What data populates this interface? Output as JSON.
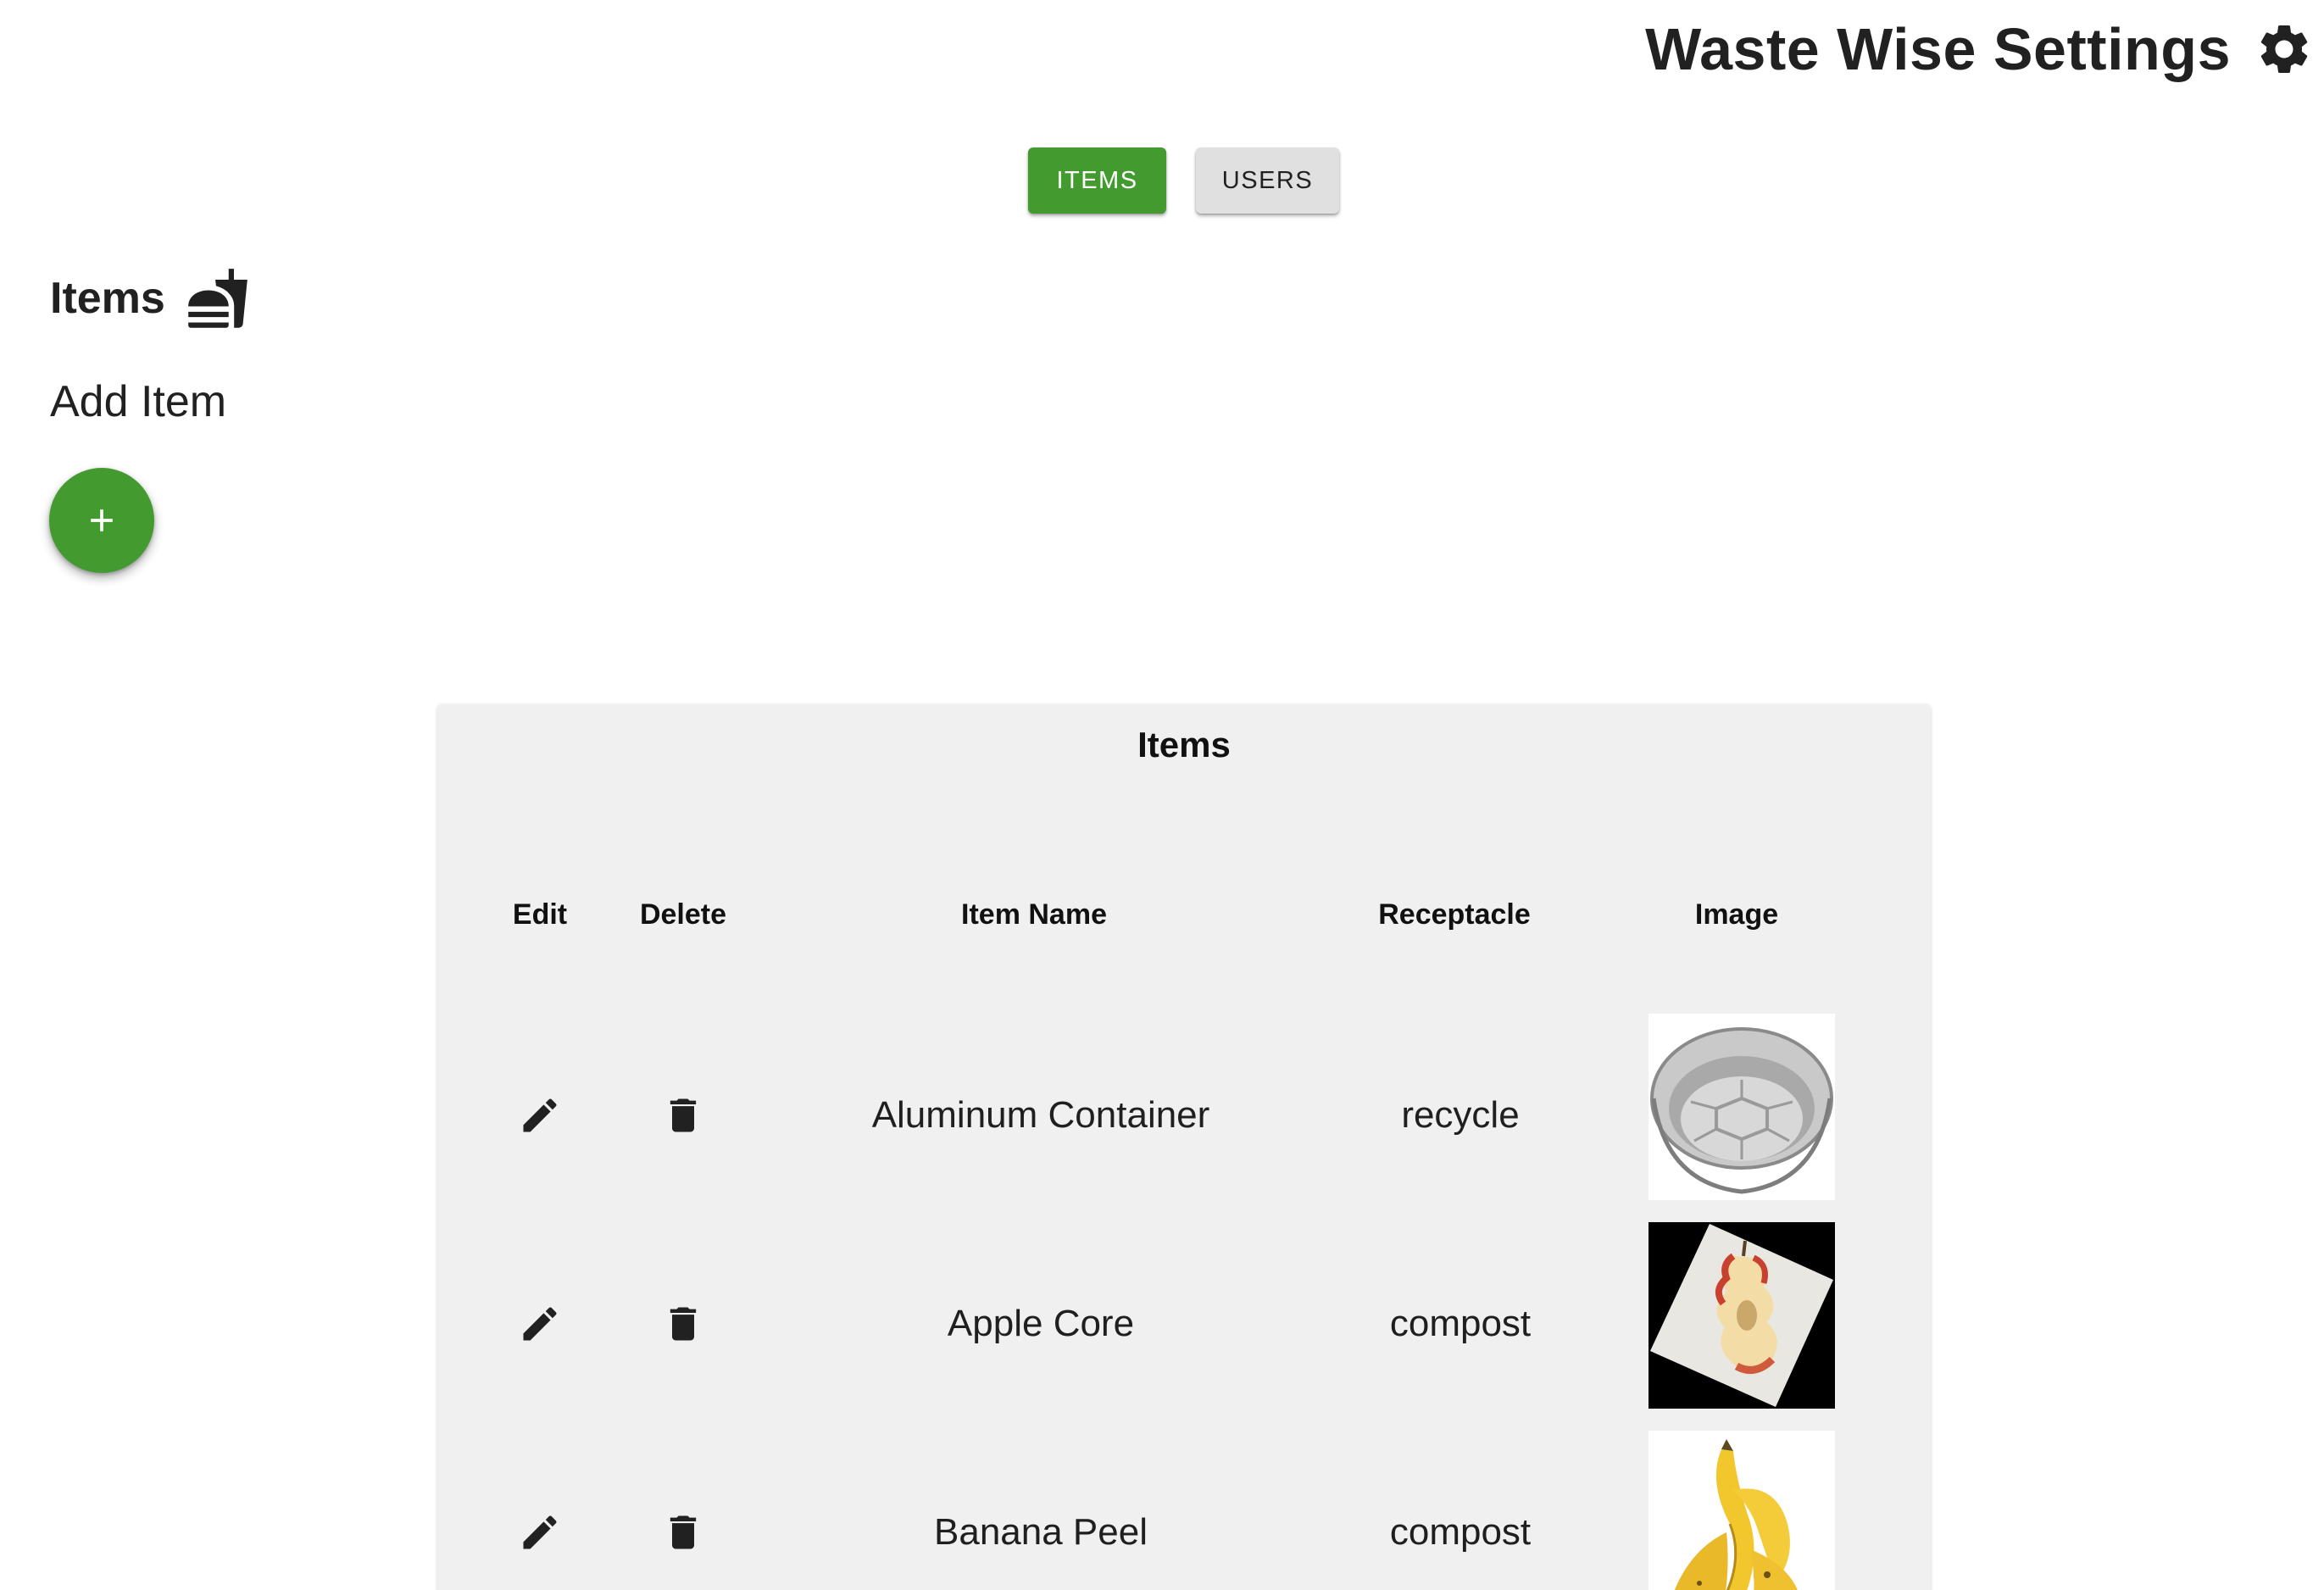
{
  "header": {
    "title": "Waste Wise Settings",
    "settings_icon": "gear-icon"
  },
  "tabs": [
    {
      "label": "ITEMS",
      "active": true,
      "color": "#439a2f"
    },
    {
      "label": "USERS",
      "active": false,
      "color": "#e0e0e0"
    }
  ],
  "section": {
    "title": "Items",
    "icon": "fastfood-icon",
    "add_label": "Add Item",
    "add_icon": "plus-icon"
  },
  "table": {
    "title": "Items",
    "columns": [
      "Edit",
      "Delete",
      "Item Name",
      "Receptacle",
      "Image"
    ],
    "rows": [
      {
        "item_name": "Aluminum Container",
        "receptacle": "recycle",
        "image": "aluminum-container-image"
      },
      {
        "item_name": "Apple Core",
        "receptacle": "compost",
        "image": "apple-core-image"
      },
      {
        "item_name": "Banana Peel",
        "receptacle": "compost",
        "image": "banana-peel-image"
      }
    ]
  },
  "colors": {
    "accent": "#439a2f",
    "card_background": "#eff0ef",
    "text": "#212121"
  }
}
